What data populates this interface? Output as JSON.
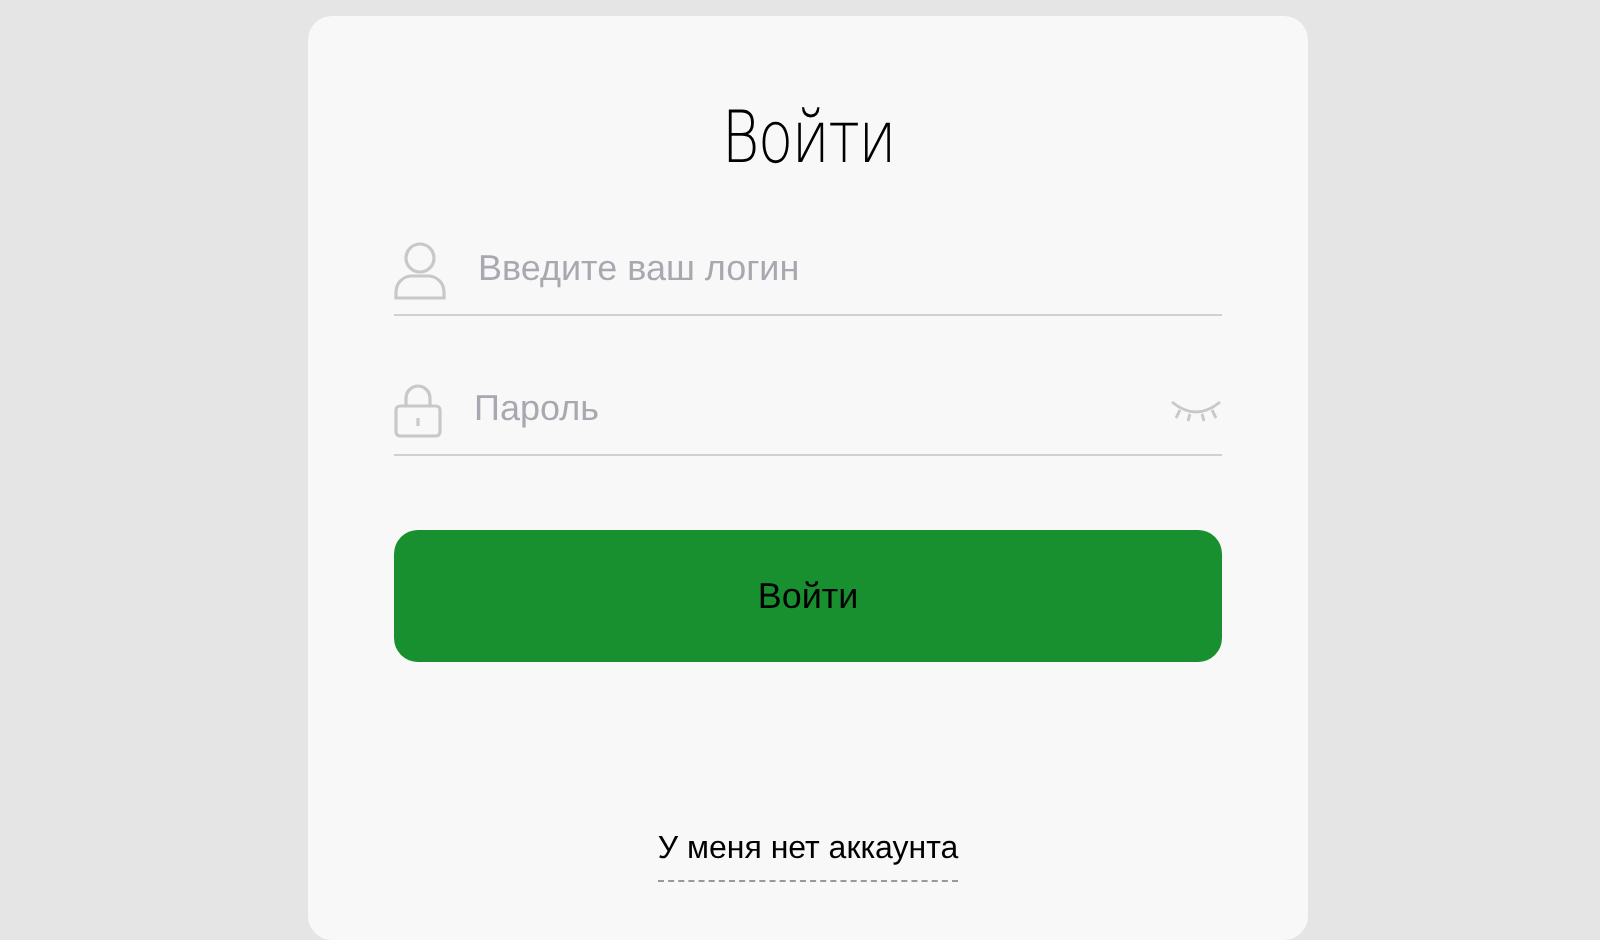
{
  "title": "Войти",
  "fields": [
    {
      "kind": "login",
      "placeholder": "Введите ваш логин"
    },
    {
      "kind": "password",
      "placeholder": "Пароль"
    }
  ],
  "submit_button": "Войти",
  "link": "У меня нет аккаунта"
}
